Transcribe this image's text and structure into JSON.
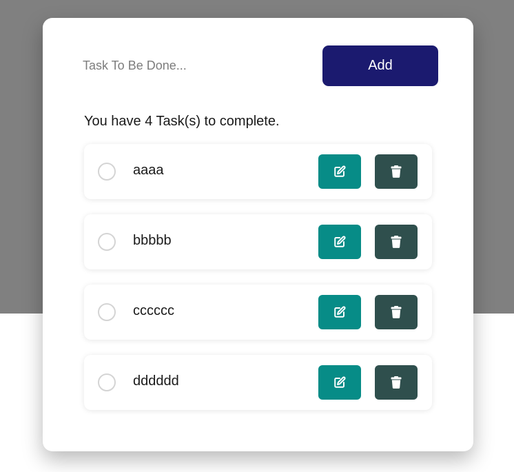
{
  "form": {
    "input_placeholder": "Task To Be Done...",
    "input_value": "",
    "add_label": "Add"
  },
  "summary": {
    "prefix": "You have ",
    "count": "4",
    "suffix": " Task(s) to complete."
  },
  "tasks": [
    {
      "text": "aaaa",
      "completed": false
    },
    {
      "text": "bbbbb",
      "completed": false
    },
    {
      "text": "cccccc",
      "completed": false
    },
    {
      "text": "dddddd",
      "completed": false
    }
  ],
  "icons": {
    "edit": "edit-icon",
    "delete": "trash-icon"
  },
  "colors": {
    "backdrop": "#808080",
    "add_button": "#1b1a6f",
    "edit_button": "#078c87",
    "delete_button": "#2f4f4d"
  }
}
